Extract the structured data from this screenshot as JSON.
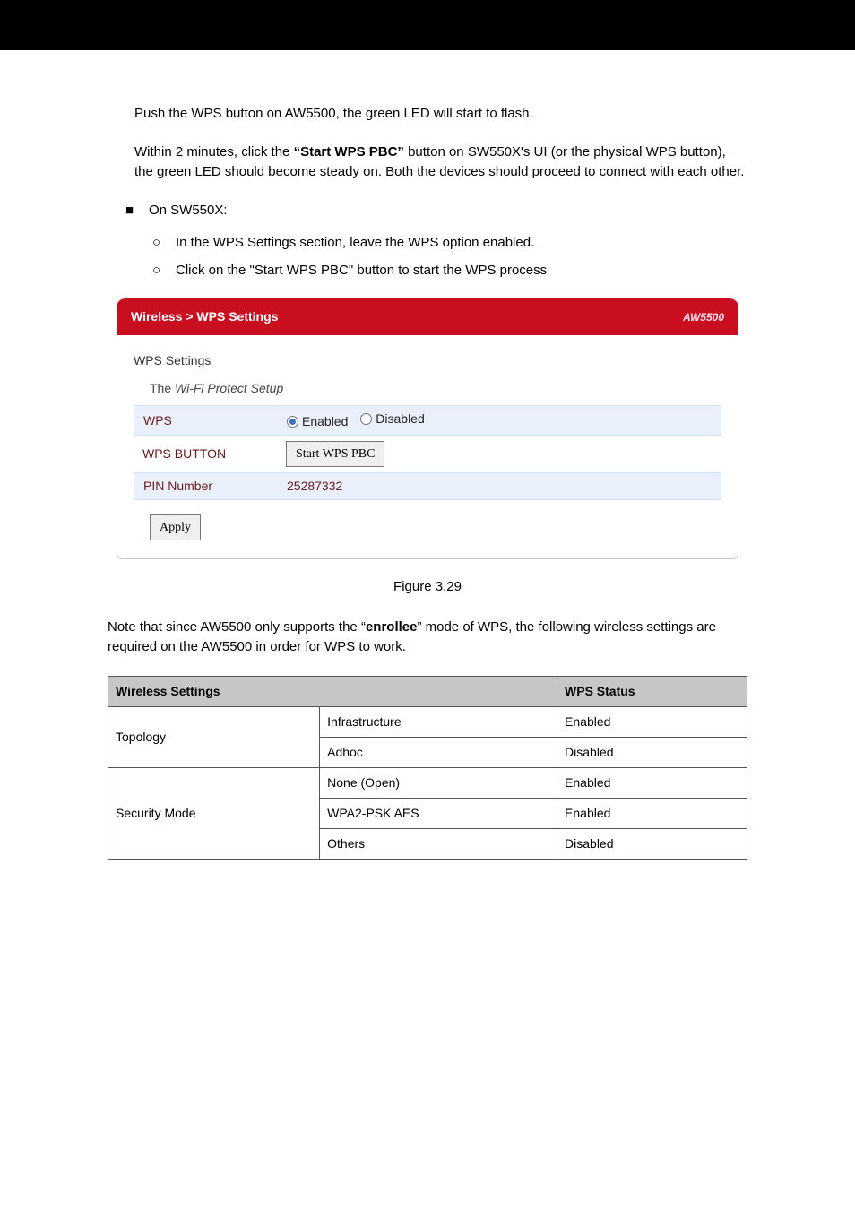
{
  "p1": "Push the WPS button on AW5500, the green LED will start to flash.",
  "p2_a": "Within 2 minutes, click the ",
  "p2_b": "“Start WPS PBC”",
  "p2_c": " button on SW550X's UI (or the physical WPS button), the green LED should become steady on. Both the devices should proceed to connect with each other.",
  "bullet_root": "On SW550X:",
  "sub1": "In the WPS Settings section, leave the WPS option enabled.",
  "sub2": "Click on the \"Start WPS PBC\" button to start the WPS process",
  "fig_caption": "Figure 3.29",
  "panel": {
    "breadcrumb": "Wireless > WPS Settings",
    "brand": "AW5500",
    "title": "WPS Settings",
    "subtitle_a": "The ",
    "subtitle_b": "Wi-Fi Protect Setup",
    "row_wps": "WPS",
    "row_wps_btn": "WPS BUTTON",
    "row_pin": "PIN Number",
    "enabled": "Enabled",
    "disabled": "Disabled",
    "start_btn": "Start WPS PBC",
    "pin_value": "25287332",
    "apply": "Apply"
  },
  "note_a": "Note that since AW5500 only supports the “",
  "note_b": "enrollee",
  "note_c": "” mode of WPS, the following wireless settings are required on the AW5500 in order for WPS to work.",
  "table": {
    "h1": "Wireless Settings",
    "h2": "WPS Status",
    "r1c1": "Topology",
    "r1c2a": "Infrastructure",
    "r1c2b": "Adhoc",
    "r1c3a": "Enabled",
    "r1c3b": "Disabled",
    "r2c1": "Security Mode",
    "r2c2a": "None (Open)",
    "r2c2b": "WPA2-PSK AES",
    "r2c2c": "Others",
    "r2c3a": "Enabled",
    "r2c3b": "Enabled",
    "r2c3c": "Disabled"
  }
}
